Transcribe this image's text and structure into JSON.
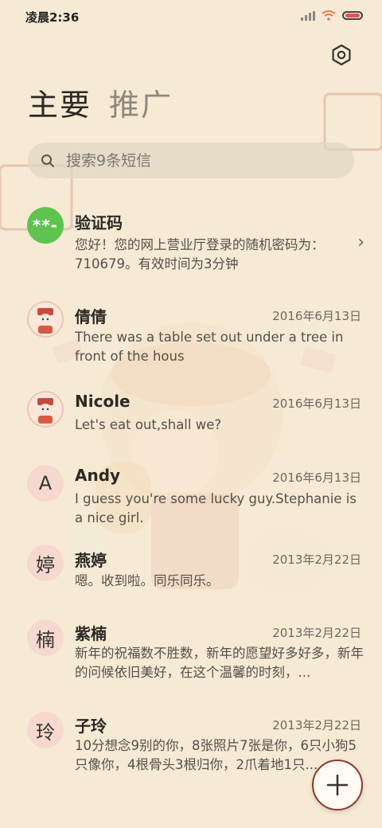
{
  "status_bar": {
    "time": "凌晨2:36"
  },
  "tabs": [
    {
      "label": "主要",
      "active": true
    },
    {
      "label": "推广",
      "active": false
    }
  ],
  "search": {
    "placeholder": "搜索9条短信"
  },
  "messages": [
    {
      "avatar_text": "**-",
      "name": "验证码",
      "date": "",
      "preview": "您好！您的网上营业厅登录的随机密码为：710679。有效时间为3分钟"
    },
    {
      "avatar_text": "",
      "name": "倩倩",
      "date": "2016年6月13日",
      "preview": "There was a table set out under a tree in front of the hous"
    },
    {
      "avatar_text": "",
      "name": "Nicole",
      "date": "2016年6月13日",
      "preview": "Let's eat out,shall we?"
    },
    {
      "avatar_text": "A",
      "name": "Andy",
      "date": "2016年6月13日",
      "preview": "I guess you're some lucky guy.Stephanie is a nice girl."
    },
    {
      "avatar_text": "婷",
      "name": "燕婷",
      "date": "2013年2月22日",
      "preview": "嗯。收到啦。同乐同乐。"
    },
    {
      "avatar_text": "楠",
      "name": "紫楠",
      "date": "2013年2月22日",
      "preview": "新年的祝福数不胜数，新年的愿望好多好多，新年的问候依旧美好，在这个温馨的时刻，..."
    },
    {
      "avatar_text": "玲",
      "name": "子玲",
      "date": "2013年2月22日",
      "preview": "10分想念9别的你，8张照片7张是你，6只小狗5只像你，4根骨头3根归你，2爪着地1只..."
    }
  ],
  "colors": {
    "accent_green": "#5ec44f",
    "avatar_pink": "#f7d8cf",
    "background": "#f6ead5"
  },
  "icons": {
    "settings": "settings-icon",
    "search": "search-icon",
    "fab": "plus-icon",
    "chevron": "chevron-right-icon"
  }
}
